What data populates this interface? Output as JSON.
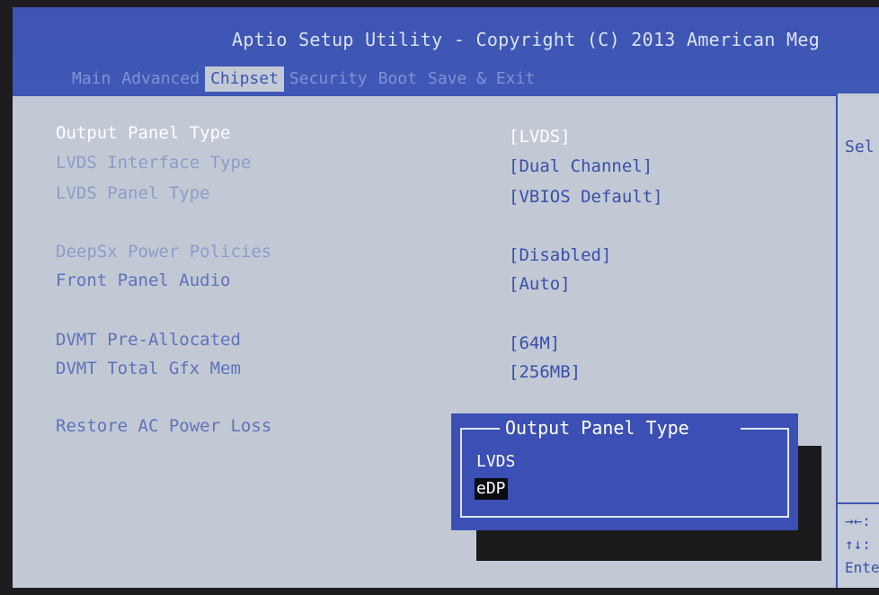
{
  "header": {
    "title": "Aptio Setup Utility - Copyright (C) 2013 American Meg",
    "tabs": [
      "Main",
      "Advanced",
      "Chipset",
      "Security",
      "Boot",
      "Save & Exit"
    ],
    "active_tab": "Chipset"
  },
  "settings": [
    {
      "label": "Output Panel Type",
      "value": "[LVDS]"
    },
    {
      "label": "LVDS Interface Type",
      "value": "[Dual Channel]"
    },
    {
      "label": "LVDS Panel Type",
      "value": "[VBIOS Default]"
    },
    {
      "label": "DeepSx Power Policies",
      "value": "[Disabled]"
    },
    {
      "label": "Front Panel Audio",
      "value": "[Auto]"
    },
    {
      "label": "DVMT Pre-Allocated",
      "value": "[64M]"
    },
    {
      "label": "DVMT Total Gfx Mem",
      "value": "[256MB]"
    },
    {
      "label": "Restore AC Power Loss",
      "value": ""
    }
  ],
  "help": {
    "text": "Sel",
    "keys": [
      "→←:",
      "↑↓:",
      "Ente"
    ]
  },
  "popup": {
    "title": "Output Panel Type",
    "options": [
      "LVDS",
      "eDP"
    ],
    "highlighted": "eDP"
  },
  "colors": {
    "accent_blue": "#3d54b2",
    "background": "#c3cad6",
    "selected_text": "#ffffff"
  }
}
